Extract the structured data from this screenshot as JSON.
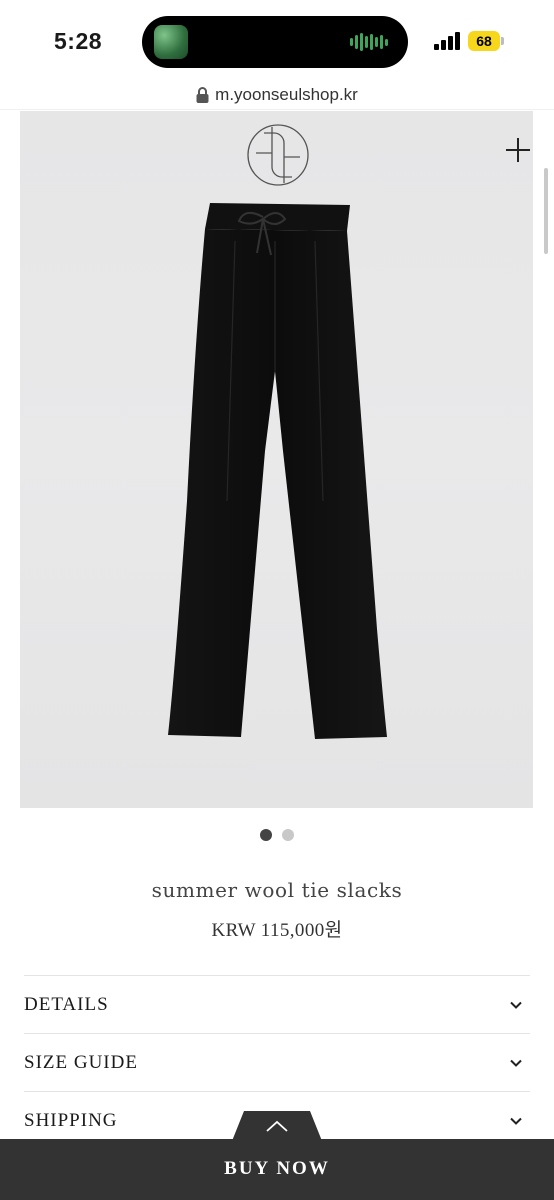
{
  "status_bar": {
    "time": "5:28",
    "battery_level": "68",
    "colors": {
      "battery": "#f7d71c",
      "wave": "#3ea65a"
    }
  },
  "browser": {
    "url": "m.yoonseulshop.kr"
  },
  "product": {
    "image_count": 2,
    "active_image": 1,
    "name": "summer wool tie slacks",
    "price": "KRW 115,000원"
  },
  "accordion": {
    "items": [
      {
        "label": "DETAILS",
        "icon": "chevron-down-icon"
      },
      {
        "label": "SIZE GUIDE",
        "icon": "chevron-down-icon"
      },
      {
        "label": "SHIPPING",
        "icon": "chevron-down-icon"
      }
    ]
  },
  "cta": {
    "label": "BUY NOW",
    "color": "#333333"
  }
}
